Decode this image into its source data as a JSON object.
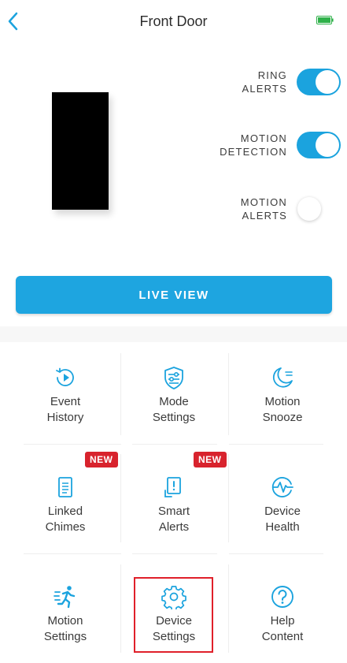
{
  "header": {
    "title": "Front Door",
    "back_icon": "chevron-left-icon",
    "battery_icon": "battery-full-icon",
    "accent_color": "#1ba3de"
  },
  "toggles": [
    {
      "label": "RING\nALERTS",
      "state": "on"
    },
    {
      "label": "MOTION\nDETECTION",
      "state": "on"
    },
    {
      "label": "MOTION\nALERTS",
      "state": "off"
    }
  ],
  "live_view": {
    "label": "LIVE VIEW"
  },
  "tiles": [
    {
      "label": "Event\nHistory",
      "icon": "play-history-icon"
    },
    {
      "label": "Mode\nSettings",
      "icon": "mode-settings-icon"
    },
    {
      "label": "Motion\nSnooze",
      "icon": "snooze-moon-icon"
    },
    {
      "label": "Linked\nChimes",
      "icon": "chime-device-icon",
      "badge": "NEW"
    },
    {
      "label": "Smart\nAlerts",
      "icon": "smart-alert-icon",
      "badge": "NEW"
    },
    {
      "label": "Device\nHealth",
      "icon": "health-pulse-icon"
    },
    {
      "label": "Motion\nSettings",
      "icon": "running-person-icon"
    },
    {
      "label": "Device\nSettings",
      "icon": "gear-icon"
    },
    {
      "label": "Help\nContent",
      "icon": "question-circle-icon"
    }
  ]
}
